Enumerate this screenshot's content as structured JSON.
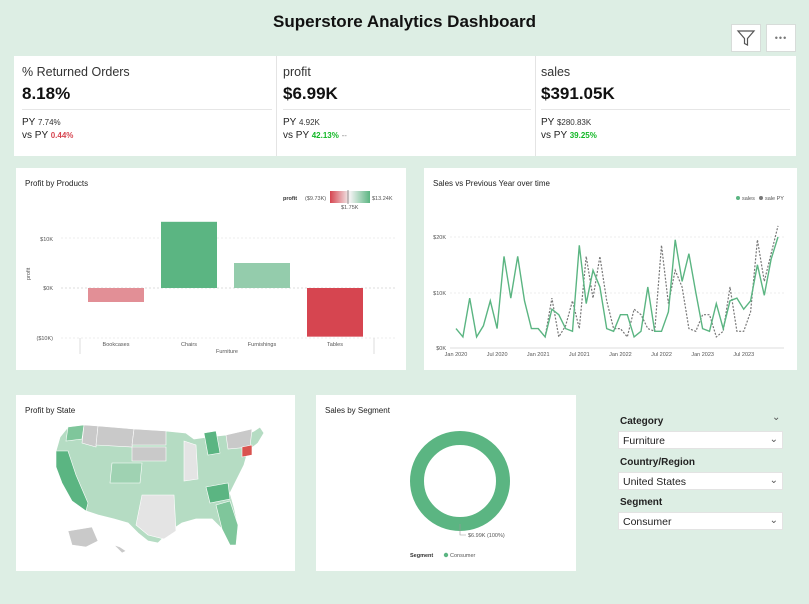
{
  "header": {
    "title": "Superstore Analytics Dashboard"
  },
  "toolbar": {
    "filter_icon": "filter-icon",
    "more_icon": "more-options-icon",
    "more_label": "•••"
  },
  "kpis": [
    {
      "name": "% Returned Orders",
      "value": "8.18%",
      "py_label": "PY",
      "py_value": "7.74%",
      "vs_label": "vs PY",
      "vs_value": "0.44%",
      "vs_color": "#d64550",
      "vs_suffix": ""
    },
    {
      "name": "profit",
      "value": "$6.99K",
      "py_label": "PY",
      "py_value": "4.92K",
      "vs_label": "vs PY",
      "vs_value": "42.13%",
      "vs_color": "#12b826",
      "vs_suffix": "--"
    },
    {
      "name": "sales",
      "value": "$391.05K",
      "py_label": "PY",
      "py_value": "$280.83K",
      "vs_label": "vs PY",
      "vs_value": "39.25%",
      "vs_color": "#12b826",
      "vs_suffix": ""
    }
  ],
  "profit_by_products": {
    "title": "Profit by Products",
    "legend_title": "profit",
    "legend_min": "($9.73K)",
    "legend_mid": "$1.75K",
    "legend_max": "$13.24K",
    "ylabel": "profit",
    "xlabel": "Furniture",
    "yticks": [
      "$10K",
      "$0K",
      "($10K)"
    ],
    "colors": {
      "neg": "#d64550",
      "pos": "#5bb582"
    }
  },
  "sales_vs_py": {
    "title": "Sales vs Previous Year over time",
    "legend_sales": "sales",
    "legend_py": "sale PY",
    "yticks": [
      "$20K",
      "$10K",
      "$0K"
    ],
    "xticks": [
      "Jan 2020",
      "Jul 2020",
      "Jan 2021",
      "Jul 2021",
      "Jan 2022",
      "Jul 2022",
      "Jan 2023",
      "Jul 2023"
    ]
  },
  "profit_by_state": {
    "title": "Profit by State"
  },
  "sales_by_segment": {
    "title": "Sales by Segment",
    "data_label": "$6.99K (100%)",
    "legend_title": "Segment",
    "legend_item": "Consumer"
  },
  "slicers": [
    {
      "label": "Category",
      "value": "Furniture"
    },
    {
      "label": "Country/Region",
      "value": "United States"
    },
    {
      "label": "Segment",
      "value": "Consumer"
    }
  ],
  "chart_data": [
    {
      "type": "bar",
      "title": "Profit by Products",
      "xlabel": "Furniture",
      "ylabel": "profit",
      "categories": [
        "Bookcases",
        "Chairs",
        "Furnishings",
        "Tables"
      ],
      "values": [
        -2.8,
        13.24,
        5.0,
        -9.73
      ],
      "units": "$K",
      "ylim": [
        -10,
        15
      ]
    },
    {
      "type": "line",
      "title": "Sales vs Previous Year over time",
      "x": [
        "2020-01",
        "2020-02",
        "2020-03",
        "2020-04",
        "2020-05",
        "2020-06",
        "2020-07",
        "2020-08",
        "2020-09",
        "2020-10",
        "2020-11",
        "2020-12",
        "2021-01",
        "2021-02",
        "2021-03",
        "2021-04",
        "2021-05",
        "2021-06",
        "2021-07",
        "2021-08",
        "2021-09",
        "2021-10",
        "2021-11",
        "2021-12",
        "2022-01",
        "2022-02",
        "2022-03",
        "2022-04",
        "2022-05",
        "2022-06",
        "2022-07",
        "2022-08",
        "2022-09",
        "2022-10",
        "2022-11",
        "2022-12",
        "2023-01",
        "2023-02",
        "2023-03",
        "2023-04",
        "2023-05",
        "2023-06",
        "2023-07",
        "2023-08",
        "2023-09",
        "2023-10",
        "2023-11",
        "2023-12"
      ],
      "series": [
        {
          "name": "sales",
          "values": [
            3.5,
            2,
            9,
            2,
            4,
            8.5,
            3.5,
            16.5,
            9,
            16.5,
            8.5,
            3.5,
            3.5,
            2,
            7,
            6,
            3.5,
            3,
            18.5,
            8,
            14,
            11,
            3.5,
            3,
            6,
            6,
            2,
            3,
            11,
            3,
            3,
            6.5,
            19.5,
            12,
            17,
            10,
            3.5,
            3,
            8,
            3.5,
            8.5,
            9,
            7,
            8.5,
            15,
            9.5,
            16,
            20
          ]
        },
        {
          "name": "sale PY",
          "values": [
            null,
            null,
            null,
            null,
            null,
            null,
            null,
            null,
            null,
            null,
            null,
            null,
            3.5,
            2,
            9,
            2,
            4,
            8.5,
            3.5,
            16.5,
            9,
            16.5,
            8.5,
            3.5,
            3.5,
            2,
            7,
            6,
            3.5,
            3,
            18.5,
            8,
            14,
            11,
            3.5,
            3,
            6,
            6,
            2,
            3,
            11,
            3,
            3,
            6.5,
            19.5,
            12,
            17,
            22
          ]
        }
      ],
      "ylim": [
        0,
        22
      ],
      "units": "$K"
    },
    {
      "type": "pie",
      "title": "Sales by Segment",
      "categories": [
        "Consumer"
      ],
      "values": [
        6.99
      ],
      "units": "$K",
      "percent": [
        100
      ]
    }
  ]
}
